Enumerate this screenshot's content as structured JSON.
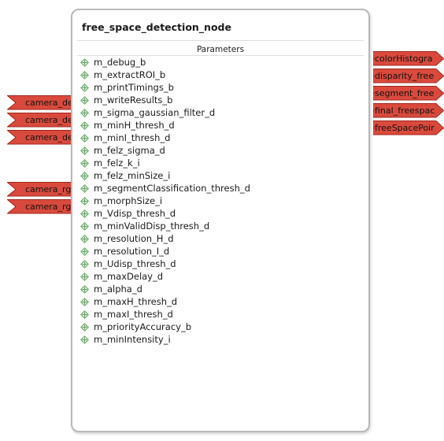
{
  "node": {
    "title": "free_space_detection_node",
    "parameters_header": "Parameters",
    "parameters": [
      "m_debug_b",
      "m_extractROI_b",
      "m_printTimings_b",
      "m_writeResults_b",
      "m_sigma_gaussian_filter_d",
      "m_minH_thresh_d",
      "m_minI_thresh_d",
      "m_felz_sigma_d",
      "m_felz_k_i",
      "m_felz_minSize_i",
      "m_segmentClassification_thresh_d",
      "m_morphSize_i",
      "m_Vdisp_thresh_d",
      "m_minValidDisp_thresh_d",
      "m_resolution_H_d",
      "m_resolution_I_d",
      "m_Udisp_thresh_d",
      "m_maxDelay_d",
      "m_alpha_d",
      "m_maxH_thresh_d",
      "m_maxI_thresh_d",
      "m_priorityAccuracy_b",
      "m_minIntensity_i"
    ],
    "param_icon": "diamond-cross-icon"
  },
  "input_ports": [
    "camera_de",
    "camera_de",
    "camera_de",
    "camera_rg",
    "camera_rg"
  ],
  "output_ports": [
    "colorHistogra",
    "disparity_free",
    "segment_free",
    "final_freespac",
    "freeSpacePoir"
  ],
  "colors": {
    "port_fill": "#d94a3d",
    "port_stroke": "#a3271d",
    "node_border": "#b9b9b9",
    "param_icon": "#5fa05c"
  }
}
